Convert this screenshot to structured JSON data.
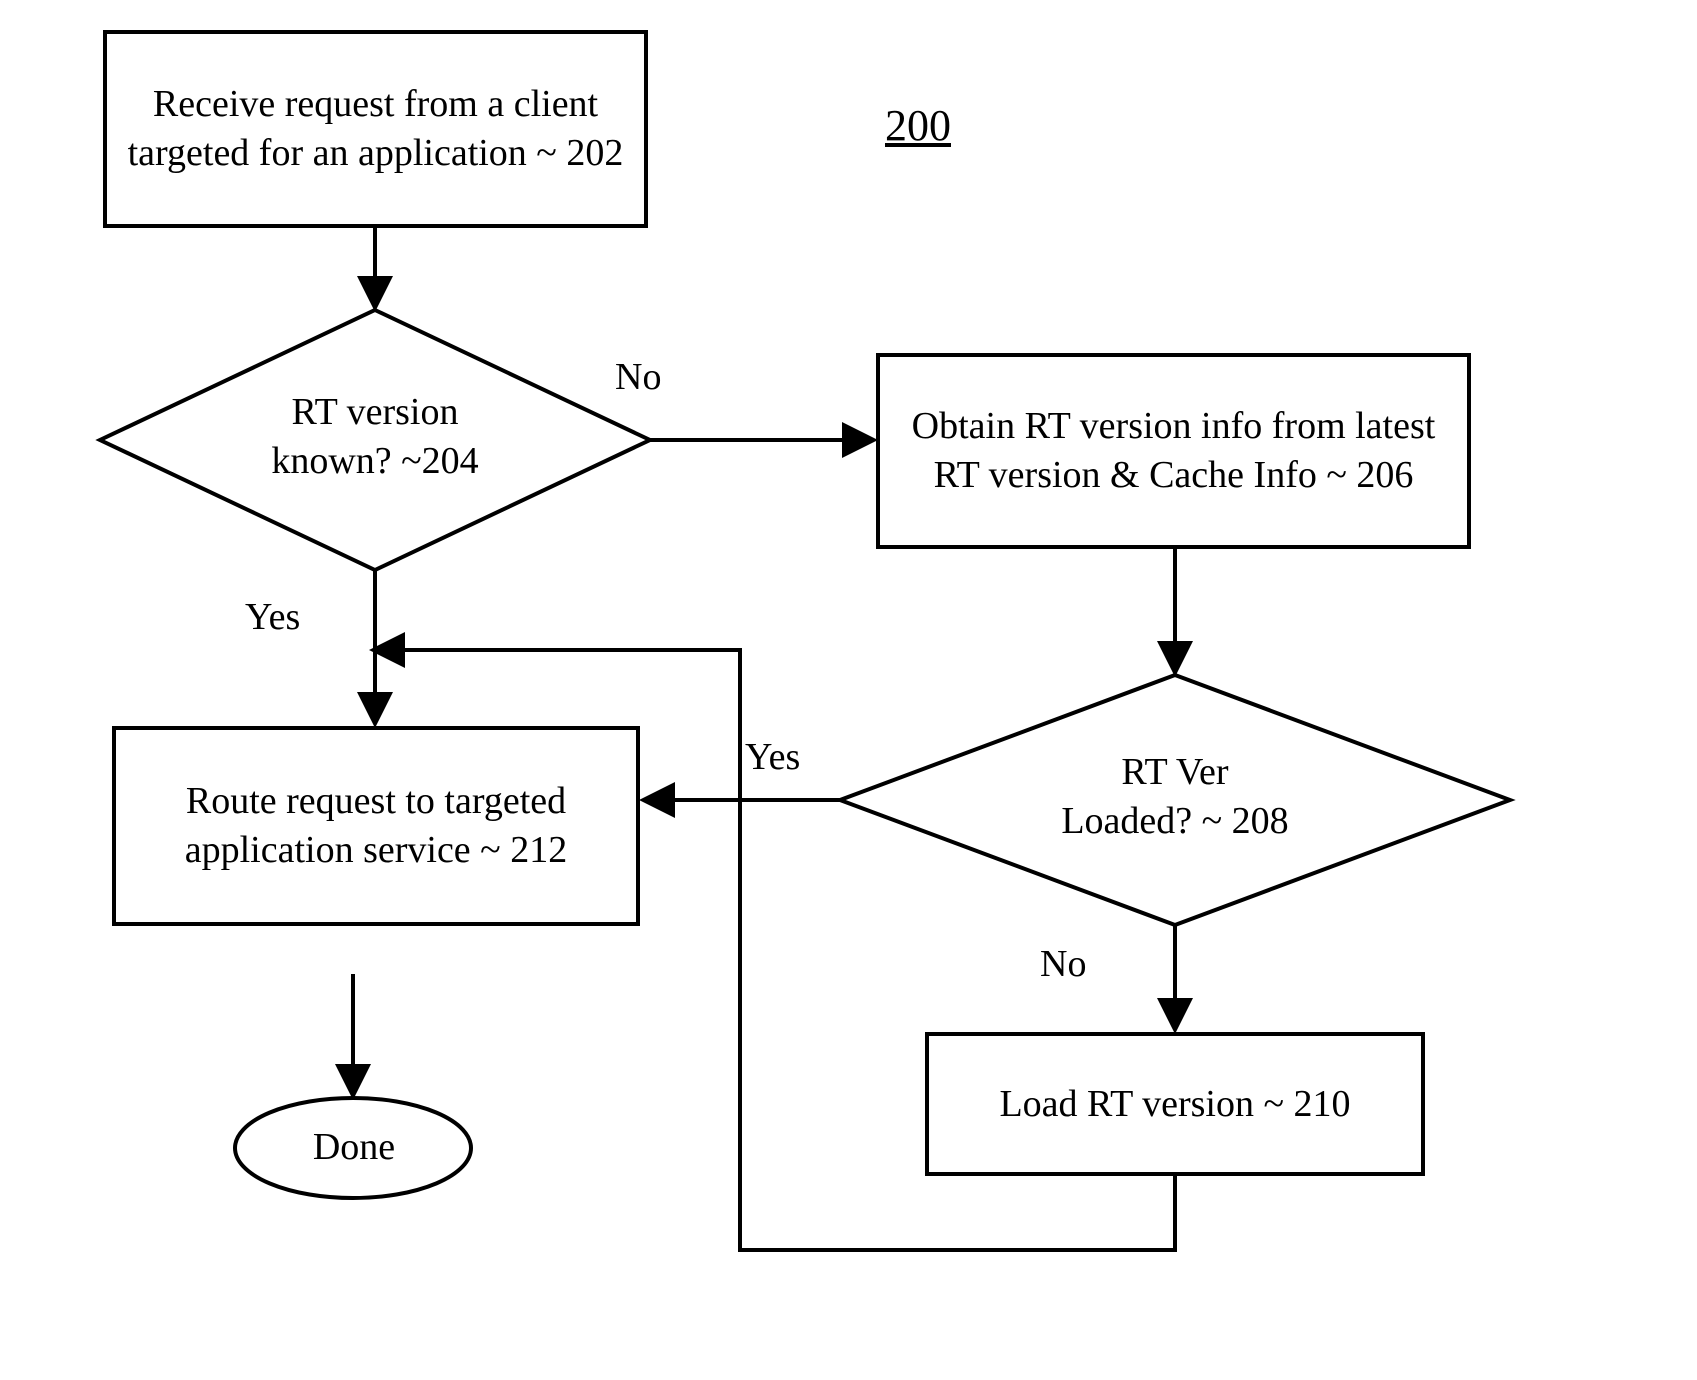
{
  "figure_label": "200",
  "nodes": {
    "n202": {
      "text": "Receive request from a\nclient targeted for an\napplication ~ 202"
    },
    "n204": {
      "text": "RT version\nknown? ~204"
    },
    "n206": {
      "text": "Obtain RT version info\nfrom latest RT version &\nCache Info ~ 206"
    },
    "n208": {
      "text": "RT Ver\nLoaded? ~ 208"
    },
    "n210": {
      "text": "Load RT version\n~ 210"
    },
    "n212": {
      "text": "Route request to\ntargeted application\nservice ~ 212"
    },
    "done": {
      "text": "Done"
    }
  },
  "edges": {
    "no204": "No",
    "yes204": "Yes",
    "yes208": "Yes",
    "no208": "No"
  }
}
